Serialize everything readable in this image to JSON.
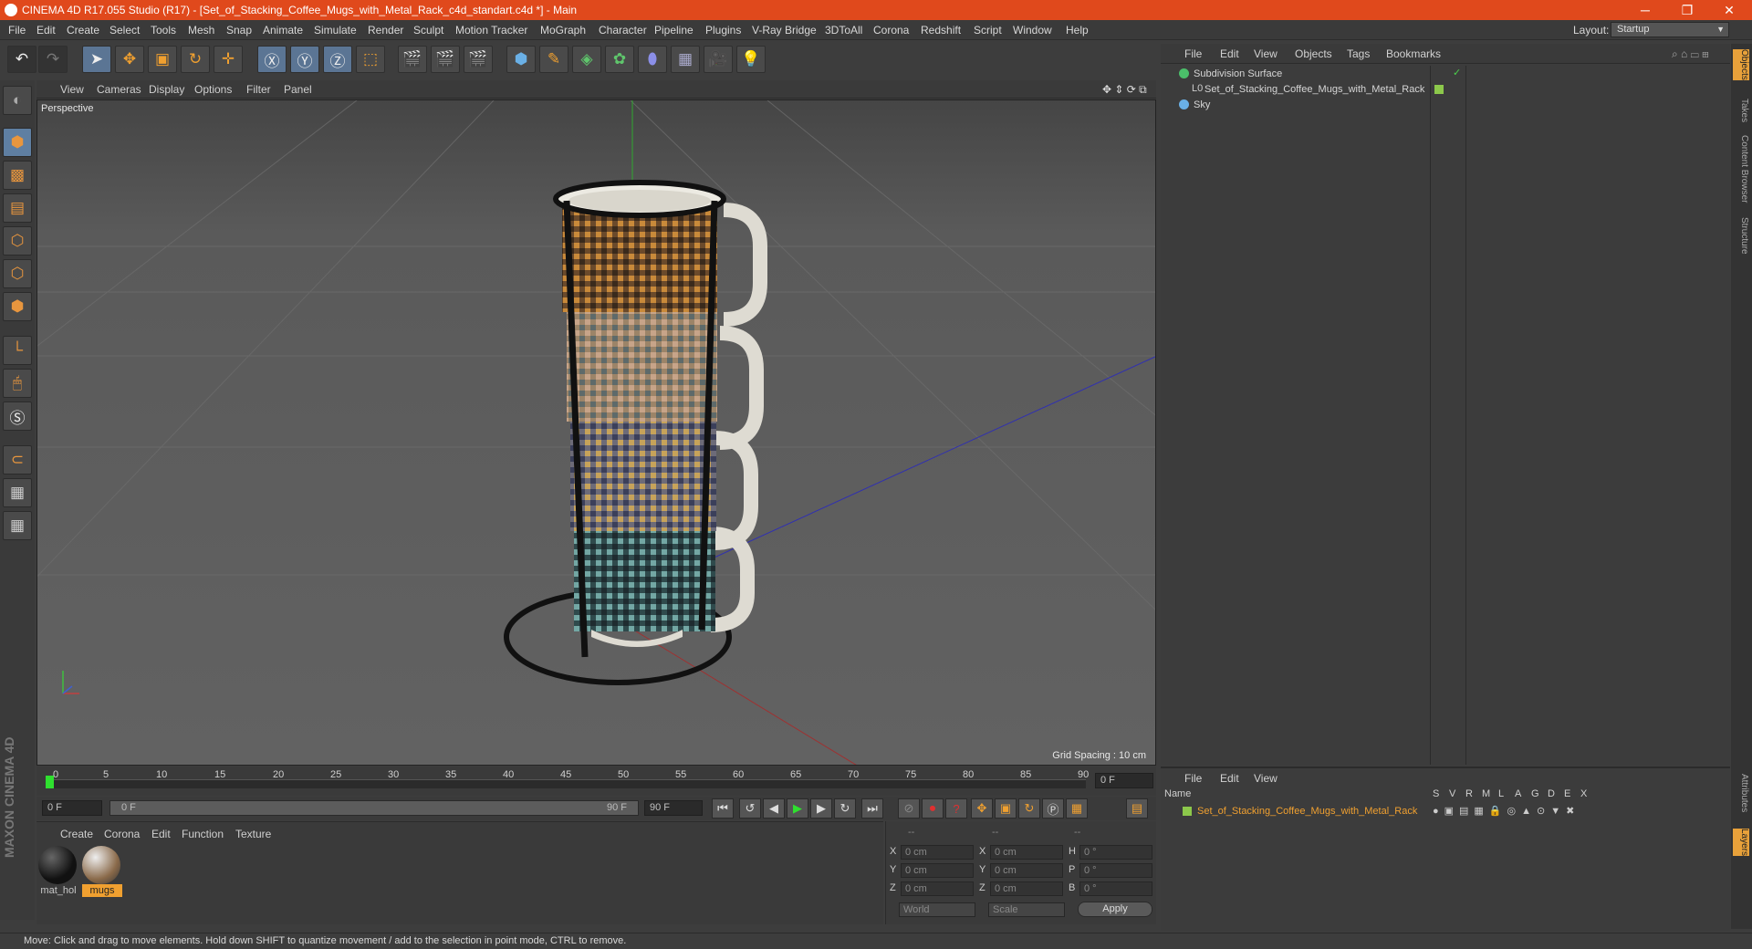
{
  "titlebar": {
    "title": "CINEMA 4D R17.055 Studio (R17) - [Set_of_Stacking_Coffee_Mugs_with_Metal_Rack_c4d_standart.c4d *] - Main",
    "minimize": "─",
    "restore": "❐",
    "close": "✕"
  },
  "menubar": {
    "items": [
      "File",
      "Edit",
      "Create",
      "Select",
      "Tools",
      "Mesh",
      "Snap",
      "Animate",
      "Simulate",
      "Render",
      "Sculpt",
      "Motion Tracker",
      "MoGraph",
      "Character",
      "Pipeline",
      "Plugins",
      "V-Ray Bridge",
      "3DToAll",
      "Corona",
      "Redshift",
      "Script",
      "Window",
      "Help"
    ],
    "layout_label": "Layout:",
    "layout_value": "Startup"
  },
  "viewport": {
    "menu": [
      "View",
      "Cameras",
      "Display",
      "Options",
      "Filter",
      "Panel"
    ],
    "label": "Perspective",
    "grid_spacing": "Grid Spacing : 10 cm"
  },
  "timeline": {
    "ticks": [
      "0",
      "5",
      "10",
      "15",
      "20",
      "25",
      "30",
      "35",
      "40",
      "45",
      "50",
      "55",
      "60",
      "65",
      "70",
      "75",
      "80",
      "85",
      "90"
    ],
    "frame_field": "0 F",
    "start_field": "0 F",
    "range_left": "0 F",
    "range_right": "90 F",
    "end_field": "90 F"
  },
  "materials": {
    "menu": [
      "Create",
      "Corona",
      "Edit",
      "Function",
      "Texture"
    ],
    "items": [
      {
        "label": "mat_hol"
      },
      {
        "label": "mugs"
      }
    ]
  },
  "coords": {
    "header": [
      "--",
      "--",
      "--"
    ],
    "rows": [
      {
        "a": "X",
        "av": "0 cm",
        "b": "X",
        "bv": "0 cm",
        "c": "H",
        "cv": "0 °"
      },
      {
        "a": "Y",
        "av": "0 cm",
        "b": "Y",
        "bv": "0 cm",
        "c": "P",
        "cv": "0 °"
      },
      {
        "a": "Z",
        "av": "0 cm",
        "b": "Z",
        "bv": "0 cm",
        "c": "B",
        "cv": "0 °"
      }
    ],
    "world": "World",
    "scale": "Scale",
    "apply": "Apply"
  },
  "objects": {
    "menu": [
      "File",
      "Edit",
      "View",
      "Objects",
      "Tags",
      "Bookmarks"
    ],
    "rows": [
      {
        "name": "Subdivision Surface"
      },
      {
        "name": "Set_of_Stacking_Coffee_Mugs_with_Metal_Rack"
      },
      {
        "name": "Sky"
      }
    ]
  },
  "layers": {
    "menu": [
      "File",
      "Edit",
      "View"
    ],
    "header_name": "Name",
    "cols": [
      "S",
      "V",
      "R",
      "M",
      "L",
      "A",
      "G",
      "D",
      "E",
      "X"
    ],
    "row": "Set_of_Stacking_Coffee_Mugs_with_Metal_Rack"
  },
  "right_tabs": [
    "Objects",
    "Takes",
    "Content Browser",
    "Structure",
    "Attributes",
    "Layers"
  ],
  "status": "Move: Click and drag to move elements. Hold down SHIFT to quantize movement / add to the selection in point mode, CTRL to remove.",
  "branding": "MAXON CINEMA 4D",
  "colors": {
    "accent": "#e0491c",
    "selected": "#f0a030",
    "layer_green": "#8cc84b"
  }
}
